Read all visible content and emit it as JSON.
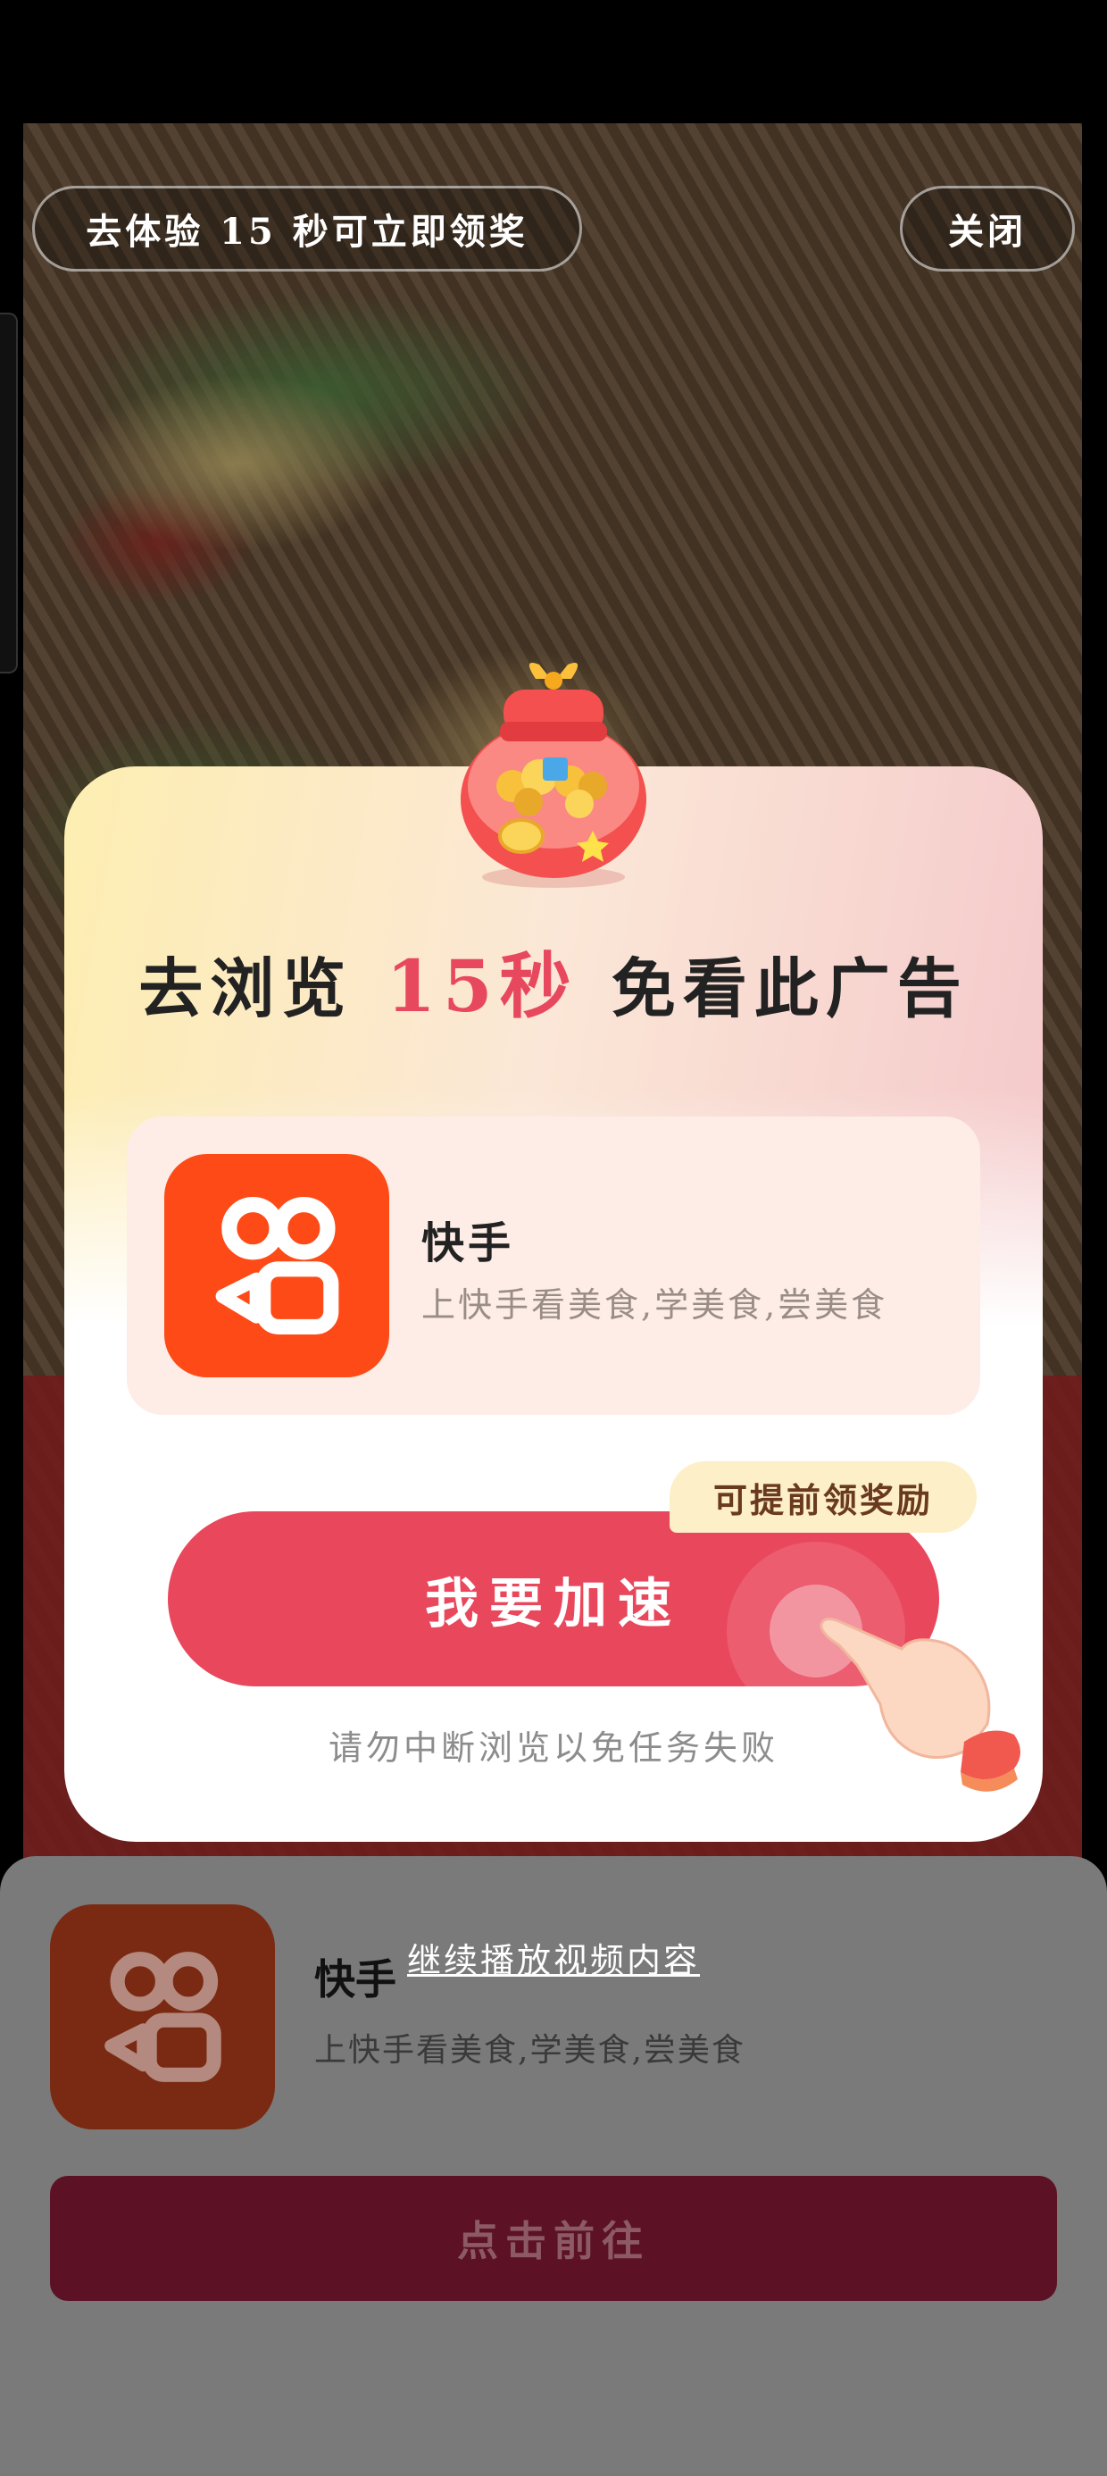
{
  "top_bar": {
    "tip_text": "去体验 15 秒可立即领奖",
    "close_label": "关闭"
  },
  "modal": {
    "title_prefix": "去浏览",
    "title_highlight": "15秒",
    "title_suffix": "免看此广告",
    "app": {
      "icon": "kuaishou-logo",
      "name": "快手",
      "description": "上快手看美食,学美食,尝美食"
    },
    "badge": "可提前领奖励",
    "speed_button": "我要加速",
    "warning": "请勿中断浏览以免任务失败",
    "colors": {
      "accent": "#e9475c",
      "brand": "#fe4a16",
      "highlight_bg": "#fde6a0"
    }
  },
  "sheet": {
    "app_name": "快手",
    "app_description": "上快手看美食,学美食,尝美食",
    "continue_link": "继续播放视频内容",
    "cta_button": "点击前往"
  }
}
